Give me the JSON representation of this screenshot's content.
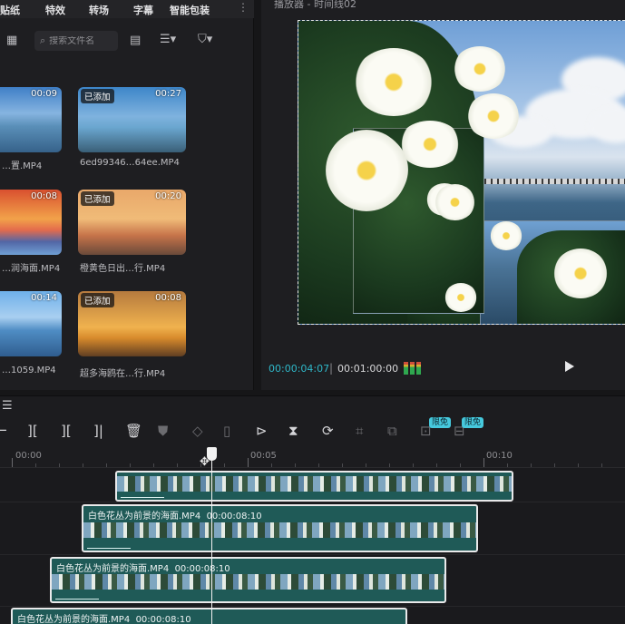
{
  "top_tabs": [
    "贴纸",
    "特效",
    "转场",
    "字幕",
    "智能包装"
  ],
  "top_tabs_more": "⋮",
  "media_panel": {
    "search_placeholder": "搜索文件名",
    "items": [
      {
        "name": "…置.MP4",
        "duration": "00:09",
        "added": ""
      },
      {
        "name": "6ed99346…64ee.MP4",
        "duration": "00:27",
        "added": "已添加"
      },
      {
        "name": "…润海面.MP4",
        "duration": "00:08",
        "added": ""
      },
      {
        "name": "橙黄色日出…行.MP4",
        "duration": "00:20",
        "added": "已添加"
      },
      {
        "name": "…1059.MP4",
        "duration": "00:14",
        "added": ""
      },
      {
        "name": "超多海鸥在…行.MP4",
        "duration": "00:08",
        "added": "已添加"
      }
    ]
  },
  "player": {
    "title": "播放器 - 时间线02",
    "current_time": "00:00:04:07",
    "separator": "|",
    "total_time": "00:01:00:00"
  },
  "timeline": {
    "free_badge": "限免",
    "ruler_labels": [
      "00:00",
      "00:05",
      "00:10"
    ],
    "clips": [
      {
        "label": "",
        "duration": ""
      },
      {
        "label": "白色花丛为前景的海面.MP4",
        "duration": "00:00:08:10"
      },
      {
        "label": "白色花丛为前景的海面.MP4",
        "duration": "00:00:08:10"
      },
      {
        "label": "白色花丛为前景的海面.MP4",
        "duration": "00:00:08:10"
      }
    ]
  },
  "colors": {
    "accent": "#2fb8c9",
    "clip": "#1f5a57",
    "badge": "#46c9dd"
  },
  "icons": [
    "grid-view-icon",
    "search-icon",
    "layout-icon",
    "sort-icon",
    "filter-icon",
    "play-icon",
    "audio-meter-icon",
    "menu-icon",
    "split-icon",
    "split-left-icon",
    "split-right-icon",
    "delete-icon",
    "shield-icon",
    "freeze-icon",
    "speed-icon",
    "mirror-icon",
    "rotate-icon",
    "crop-icon",
    "export-frame-icon",
    "smart-cut-icon",
    "playhead-icon"
  ]
}
